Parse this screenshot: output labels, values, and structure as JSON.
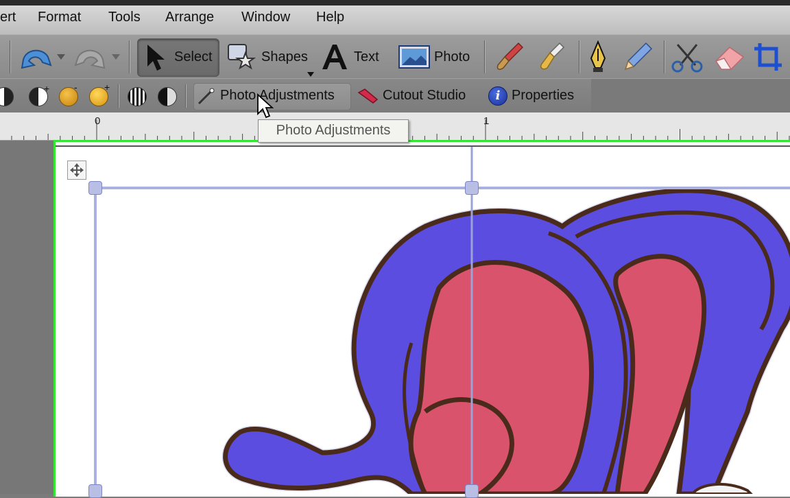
{
  "menubar": {
    "items": [
      "ert",
      "Format",
      "Tools",
      "Arrange",
      "Window",
      "Help"
    ]
  },
  "toolbar": {
    "select_label": "Select",
    "shapes_label": "Shapes",
    "text_label": "Text",
    "photo_label": "Photo"
  },
  "toolbar2": {
    "photo_adjustments_label": "Photo Adjustments",
    "cutout_studio_label": "Cutout Studio",
    "properties_label": "Properties"
  },
  "ruler": {
    "marks": [
      "0",
      "1"
    ]
  },
  "tooltip": {
    "text": "Photo Adjustments"
  },
  "icons": {
    "undo": "undo-icon",
    "redo": "redo-icon",
    "select": "arrow-pointer-icon",
    "shapes": "shapes-star-icon",
    "text": "letter-a-icon",
    "photo": "photo-icon",
    "brush": "paintbrush-icon",
    "paint": "paint-bucket-brush-icon",
    "pen": "pen-nib-icon",
    "pencil": "pencil-icon",
    "scissors": "scissors-icon",
    "eraser": "eraser-icon",
    "crop": "crop-icon",
    "properties": "info-icon",
    "cutout": "cutout-icon"
  },
  "colors": {
    "selection_border": "#33e633",
    "art_purple": "#5b4de0",
    "art_red": "#d9536d",
    "art_outline": "#4a2a1a"
  }
}
